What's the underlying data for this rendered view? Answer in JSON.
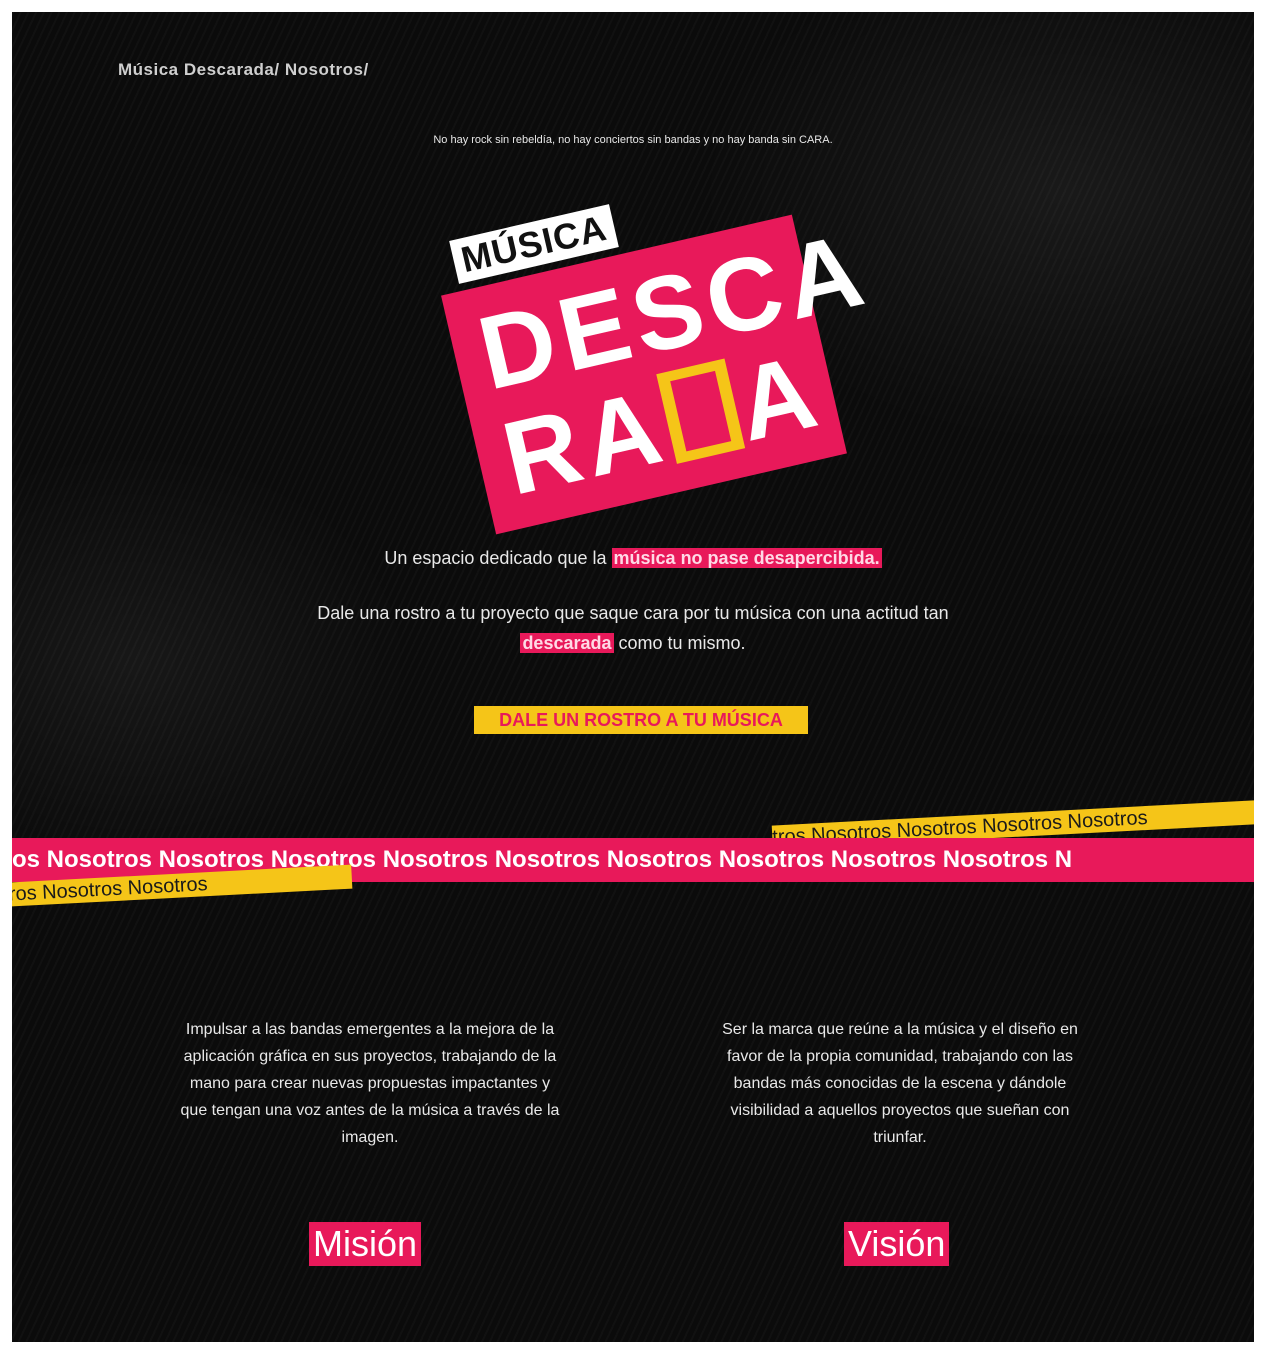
{
  "breadcrumb": [
    "Música Descarada/",
    "Nosotros/"
  ],
  "tagline": "No hay rock sin rebeldía, no hay conciertos sin bandas y no hay banda sin CARA.",
  "logo": {
    "small": "MÚSICA",
    "row1": "DESCA",
    "row2a": "RA",
    "row2b": "A"
  },
  "lead": {
    "text": "Un espacio dedicado que la",
    "highlight": "música no pase desapercibida."
  },
  "para": {
    "part1": "Dale una rostro a tu proyecto que saque cara por tu música con una actitud tan",
    "highlight": "descarada",
    "part2": "como tu mismo."
  },
  "cta_label": "DALE UN ROSTRO A TU MÚSICA",
  "marquee_text": "os Nosotros Nosotros Nosotros Nosotros Nosotros Nosotros Nosotros Nosotros Nosotros N",
  "tape_top_text": "tros Nosotros Nosotros Nosotros Nosotros",
  "tape_bottom_text": "otros Nosotros Nosotros",
  "mision": {
    "text": "Impulsar a las bandas emergentes a la mejora de la aplicación gráfica en sus proyectos, trabajando de la mano para crear nuevas propuestas impactantes y que tengan una voz antes de la música a través de la imagen.",
    "heading": "Misión"
  },
  "vision": {
    "text": "Ser la marca que reúne a la música y el diseño en favor de la propia comunidad, trabajando con las bandas más conocidas de la escena y dándole visibilidad a aquellos proyectos que sueñan con triunfar.",
    "heading": "Visión"
  },
  "colors": {
    "pink": "#e8195a",
    "yellow": "#f5c518",
    "background": "#0b0b0b"
  }
}
